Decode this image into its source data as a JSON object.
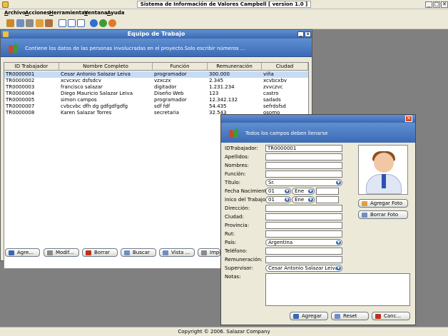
{
  "app": {
    "title": "Sistema de Información de Valores Campbell [ version 1.0 ]",
    "min": "_",
    "max": "□",
    "close": "✕"
  },
  "menu": [
    "Archivo",
    "Acciones",
    "Herramientas",
    "Ventana",
    "Ayuda"
  ],
  "toolbar_icons": [
    "open-icon",
    "folder-icon",
    "print-icon",
    "edit-icon",
    "tools-icon",
    "window-icon",
    "window-icon",
    "window-icon",
    "help-icon",
    "network-icon",
    "user-icon"
  ],
  "frame1": {
    "title": "Equipo de Trabajo",
    "header": "Contiene los datos de las personas involucradas en el proyecto.Solo escribir números ...",
    "columns": [
      "ID Trabajador",
      "Nombre Completo",
      "Función",
      "Remuneración",
      "Ciudad"
    ],
    "rows": [
      [
        "TR0000001",
        "Cesar Antonio Salazar Leiva",
        "programador",
        "300.000",
        "viña"
      ],
      [
        "TR0000002",
        "xcvcxvc dsfsdcv",
        "vzxczx",
        "2.345",
        "xcvbcxbv"
      ],
      [
        "TR0000003",
        "francisco salazar",
        "digitador",
        "1.231.234",
        "zvvczvc"
      ],
      [
        "TR0000004",
        "Diego Mauricio Salazar Leiva",
        "Diseño Web",
        "123",
        "castro"
      ],
      [
        "TR0000005",
        "simon campos",
        "programador",
        "12.342.132",
        "sadads"
      ],
      [
        "TR0000007",
        "cvbcvbc dfh dg gdfgdfgdfg",
        "sdf fdf",
        "54.435",
        "sefrdsfsd"
      ],
      [
        "TR0000008",
        "Karen Salazar Torres",
        "secretaria",
        "32.543",
        "osomo"
      ]
    ],
    "buttons": [
      "Agre...",
      "Modif...",
      "Borrar",
      "Buscar",
      "Vista ...",
      "Impo..."
    ]
  },
  "dialog": {
    "header": "Todos los campos deben llenarse",
    "close": "✕",
    "labels": {
      "id": "IDTrabajador:",
      "apellidos": "Apellidos:",
      "nombres": "Nombres:",
      "funcion": "Función:",
      "titulo": "Título:",
      "fecha_nac": "Fecha Nacimiento:",
      "inicio": "Inico del Trabajo:",
      "direccion": "Dirección:",
      "ciudad": "Ciudad:",
      "provincia": "Provincia:",
      "rut": "Rut:",
      "pais": "País:",
      "telefono": "Teléfono:",
      "remuneracion": "Remuneración:",
      "supervisor": "Supervisor:",
      "notas": "Notas:"
    },
    "values": {
      "id": "TR0000001",
      "titulo": "Sr.",
      "fecha_dia": "01",
      "fecha_mes": "Ene",
      "inicio_dia": "01",
      "inicio_mes": "Ene",
      "pais": "Argentina",
      "supervisor": "Cesar Antonio Salazar Leiva"
    },
    "photo_buttons": [
      "Agregar Foto",
      "Borrar Foto"
    ],
    "buttons": [
      "Agregar",
      "Reset",
      "Canc..."
    ]
  },
  "footer": "Copyright © 2006. Salazar Company"
}
